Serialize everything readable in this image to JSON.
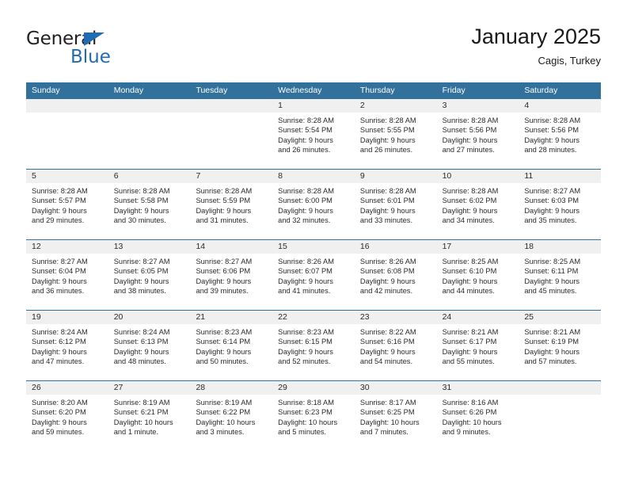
{
  "brand": {
    "name_top": "General",
    "name_bottom": "Blue",
    "triangle_color": "#1f6cb4"
  },
  "header": {
    "title": "January 2025",
    "subtitle": "Cagis, Turkey"
  },
  "theme": {
    "header_blue": "#31719b",
    "band_gray": "#f0f0f0",
    "text": "#2a2a2a"
  },
  "calendar": {
    "weekdays": [
      "Sunday",
      "Monday",
      "Tuesday",
      "Wednesday",
      "Thursday",
      "Friday",
      "Saturday"
    ],
    "weeks": [
      [
        {
          "day": ""
        },
        {
          "day": ""
        },
        {
          "day": ""
        },
        {
          "day": "1",
          "sunrise": "Sunrise: 8:28 AM",
          "sunset": "Sunset: 5:54 PM",
          "daylight1": "Daylight: 9 hours",
          "daylight2": "and 26 minutes."
        },
        {
          "day": "2",
          "sunrise": "Sunrise: 8:28 AM",
          "sunset": "Sunset: 5:55 PM",
          "daylight1": "Daylight: 9 hours",
          "daylight2": "and 26 minutes."
        },
        {
          "day": "3",
          "sunrise": "Sunrise: 8:28 AM",
          "sunset": "Sunset: 5:56 PM",
          "daylight1": "Daylight: 9 hours",
          "daylight2": "and 27 minutes."
        },
        {
          "day": "4",
          "sunrise": "Sunrise: 8:28 AM",
          "sunset": "Sunset: 5:56 PM",
          "daylight1": "Daylight: 9 hours",
          "daylight2": "and 28 minutes."
        }
      ],
      [
        {
          "day": "5",
          "sunrise": "Sunrise: 8:28 AM",
          "sunset": "Sunset: 5:57 PM",
          "daylight1": "Daylight: 9 hours",
          "daylight2": "and 29 minutes."
        },
        {
          "day": "6",
          "sunrise": "Sunrise: 8:28 AM",
          "sunset": "Sunset: 5:58 PM",
          "daylight1": "Daylight: 9 hours",
          "daylight2": "and 30 minutes."
        },
        {
          "day": "7",
          "sunrise": "Sunrise: 8:28 AM",
          "sunset": "Sunset: 5:59 PM",
          "daylight1": "Daylight: 9 hours",
          "daylight2": "and 31 minutes."
        },
        {
          "day": "8",
          "sunrise": "Sunrise: 8:28 AM",
          "sunset": "Sunset: 6:00 PM",
          "daylight1": "Daylight: 9 hours",
          "daylight2": "and 32 minutes."
        },
        {
          "day": "9",
          "sunrise": "Sunrise: 8:28 AM",
          "sunset": "Sunset: 6:01 PM",
          "daylight1": "Daylight: 9 hours",
          "daylight2": "and 33 minutes."
        },
        {
          "day": "10",
          "sunrise": "Sunrise: 8:28 AM",
          "sunset": "Sunset: 6:02 PM",
          "daylight1": "Daylight: 9 hours",
          "daylight2": "and 34 minutes."
        },
        {
          "day": "11",
          "sunrise": "Sunrise: 8:27 AM",
          "sunset": "Sunset: 6:03 PM",
          "daylight1": "Daylight: 9 hours",
          "daylight2": "and 35 minutes."
        }
      ],
      [
        {
          "day": "12",
          "sunrise": "Sunrise: 8:27 AM",
          "sunset": "Sunset: 6:04 PM",
          "daylight1": "Daylight: 9 hours",
          "daylight2": "and 36 minutes."
        },
        {
          "day": "13",
          "sunrise": "Sunrise: 8:27 AM",
          "sunset": "Sunset: 6:05 PM",
          "daylight1": "Daylight: 9 hours",
          "daylight2": "and 38 minutes."
        },
        {
          "day": "14",
          "sunrise": "Sunrise: 8:27 AM",
          "sunset": "Sunset: 6:06 PM",
          "daylight1": "Daylight: 9 hours",
          "daylight2": "and 39 minutes."
        },
        {
          "day": "15",
          "sunrise": "Sunrise: 8:26 AM",
          "sunset": "Sunset: 6:07 PM",
          "daylight1": "Daylight: 9 hours",
          "daylight2": "and 41 minutes."
        },
        {
          "day": "16",
          "sunrise": "Sunrise: 8:26 AM",
          "sunset": "Sunset: 6:08 PM",
          "daylight1": "Daylight: 9 hours",
          "daylight2": "and 42 minutes."
        },
        {
          "day": "17",
          "sunrise": "Sunrise: 8:25 AM",
          "sunset": "Sunset: 6:10 PM",
          "daylight1": "Daylight: 9 hours",
          "daylight2": "and 44 minutes."
        },
        {
          "day": "18",
          "sunrise": "Sunrise: 8:25 AM",
          "sunset": "Sunset: 6:11 PM",
          "daylight1": "Daylight: 9 hours",
          "daylight2": "and 45 minutes."
        }
      ],
      [
        {
          "day": "19",
          "sunrise": "Sunrise: 8:24 AM",
          "sunset": "Sunset: 6:12 PM",
          "daylight1": "Daylight: 9 hours",
          "daylight2": "and 47 minutes."
        },
        {
          "day": "20",
          "sunrise": "Sunrise: 8:24 AM",
          "sunset": "Sunset: 6:13 PM",
          "daylight1": "Daylight: 9 hours",
          "daylight2": "and 48 minutes."
        },
        {
          "day": "21",
          "sunrise": "Sunrise: 8:23 AM",
          "sunset": "Sunset: 6:14 PM",
          "daylight1": "Daylight: 9 hours",
          "daylight2": "and 50 minutes."
        },
        {
          "day": "22",
          "sunrise": "Sunrise: 8:23 AM",
          "sunset": "Sunset: 6:15 PM",
          "daylight1": "Daylight: 9 hours",
          "daylight2": "and 52 minutes."
        },
        {
          "day": "23",
          "sunrise": "Sunrise: 8:22 AM",
          "sunset": "Sunset: 6:16 PM",
          "daylight1": "Daylight: 9 hours",
          "daylight2": "and 54 minutes."
        },
        {
          "day": "24",
          "sunrise": "Sunrise: 8:21 AM",
          "sunset": "Sunset: 6:17 PM",
          "daylight1": "Daylight: 9 hours",
          "daylight2": "and 55 minutes."
        },
        {
          "day": "25",
          "sunrise": "Sunrise: 8:21 AM",
          "sunset": "Sunset: 6:19 PM",
          "daylight1": "Daylight: 9 hours",
          "daylight2": "and 57 minutes."
        }
      ],
      [
        {
          "day": "26",
          "sunrise": "Sunrise: 8:20 AM",
          "sunset": "Sunset: 6:20 PM",
          "daylight1": "Daylight: 9 hours",
          "daylight2": "and 59 minutes."
        },
        {
          "day": "27",
          "sunrise": "Sunrise: 8:19 AM",
          "sunset": "Sunset: 6:21 PM",
          "daylight1": "Daylight: 10 hours",
          "daylight2": "and 1 minute."
        },
        {
          "day": "28",
          "sunrise": "Sunrise: 8:19 AM",
          "sunset": "Sunset: 6:22 PM",
          "daylight1": "Daylight: 10 hours",
          "daylight2": "and 3 minutes."
        },
        {
          "day": "29",
          "sunrise": "Sunrise: 8:18 AM",
          "sunset": "Sunset: 6:23 PM",
          "daylight1": "Daylight: 10 hours",
          "daylight2": "and 5 minutes."
        },
        {
          "day": "30",
          "sunrise": "Sunrise: 8:17 AM",
          "sunset": "Sunset: 6:25 PM",
          "daylight1": "Daylight: 10 hours",
          "daylight2": "and 7 minutes."
        },
        {
          "day": "31",
          "sunrise": "Sunrise: 8:16 AM",
          "sunset": "Sunset: 6:26 PM",
          "daylight1": "Daylight: 10 hours",
          "daylight2": "and 9 minutes."
        },
        {
          "day": ""
        }
      ]
    ]
  }
}
